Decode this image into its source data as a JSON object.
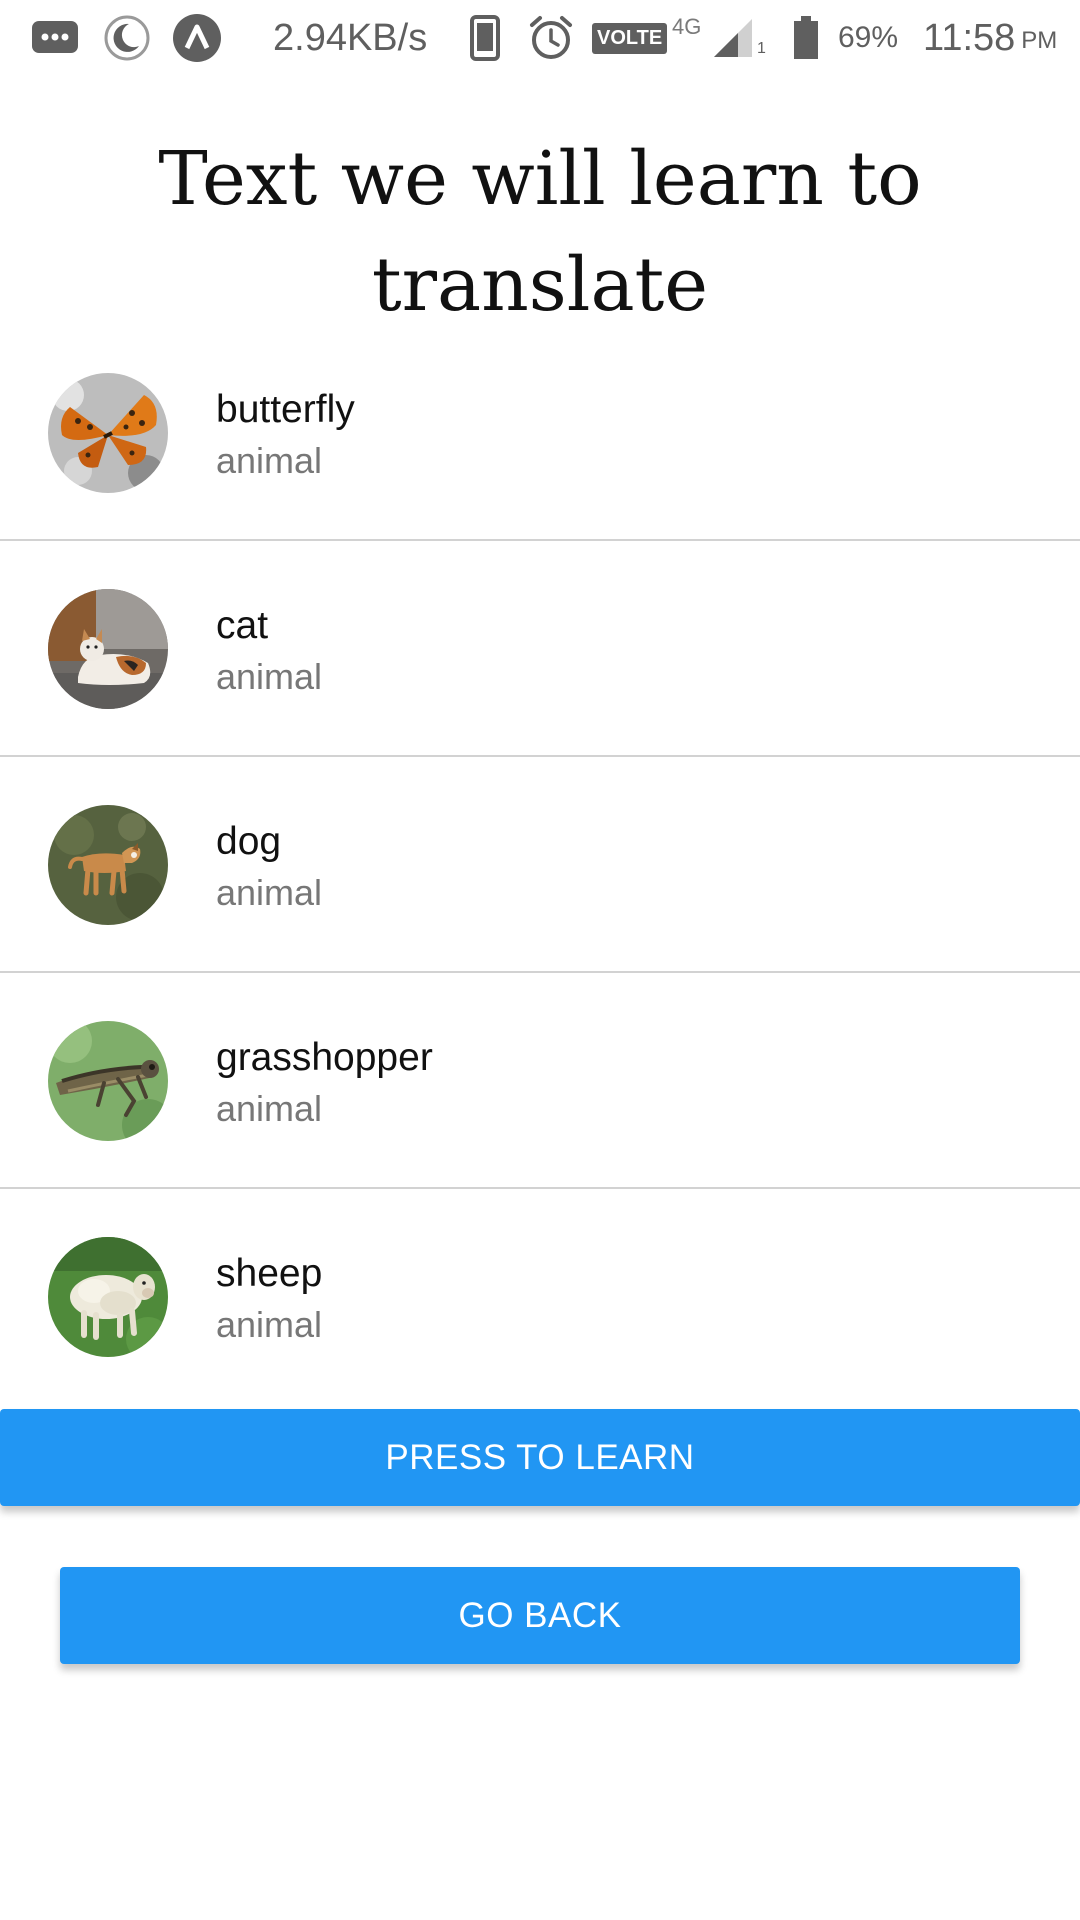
{
  "status_bar": {
    "network_speed": "2.94KB/s",
    "network_type": "4G",
    "volte_label": "VOLTE",
    "sim_slot": "1",
    "battery_percent": "69%",
    "time": "11:58",
    "time_suffix": "PM",
    "icons": [
      "messages-icon",
      "moon-icon",
      "app-icon",
      "phone-icon",
      "alarm-icon",
      "volte-icon",
      "signal-icon",
      "battery-icon"
    ]
  },
  "title": "Text we will learn to translate",
  "items": [
    {
      "title": "butterfly",
      "subtitle": "animal"
    },
    {
      "title": "cat",
      "subtitle": "animal"
    },
    {
      "title": "dog",
      "subtitle": "animal"
    },
    {
      "title": "grasshopper",
      "subtitle": "animal"
    },
    {
      "title": "sheep",
      "subtitle": "animal"
    }
  ],
  "buttons": {
    "learn_label": "PRESS TO LEARN",
    "back_label": "GO BACK"
  },
  "colors": {
    "accent": "#2196f3",
    "divider": "#d2d2d2",
    "subtitle": "#777777"
  }
}
